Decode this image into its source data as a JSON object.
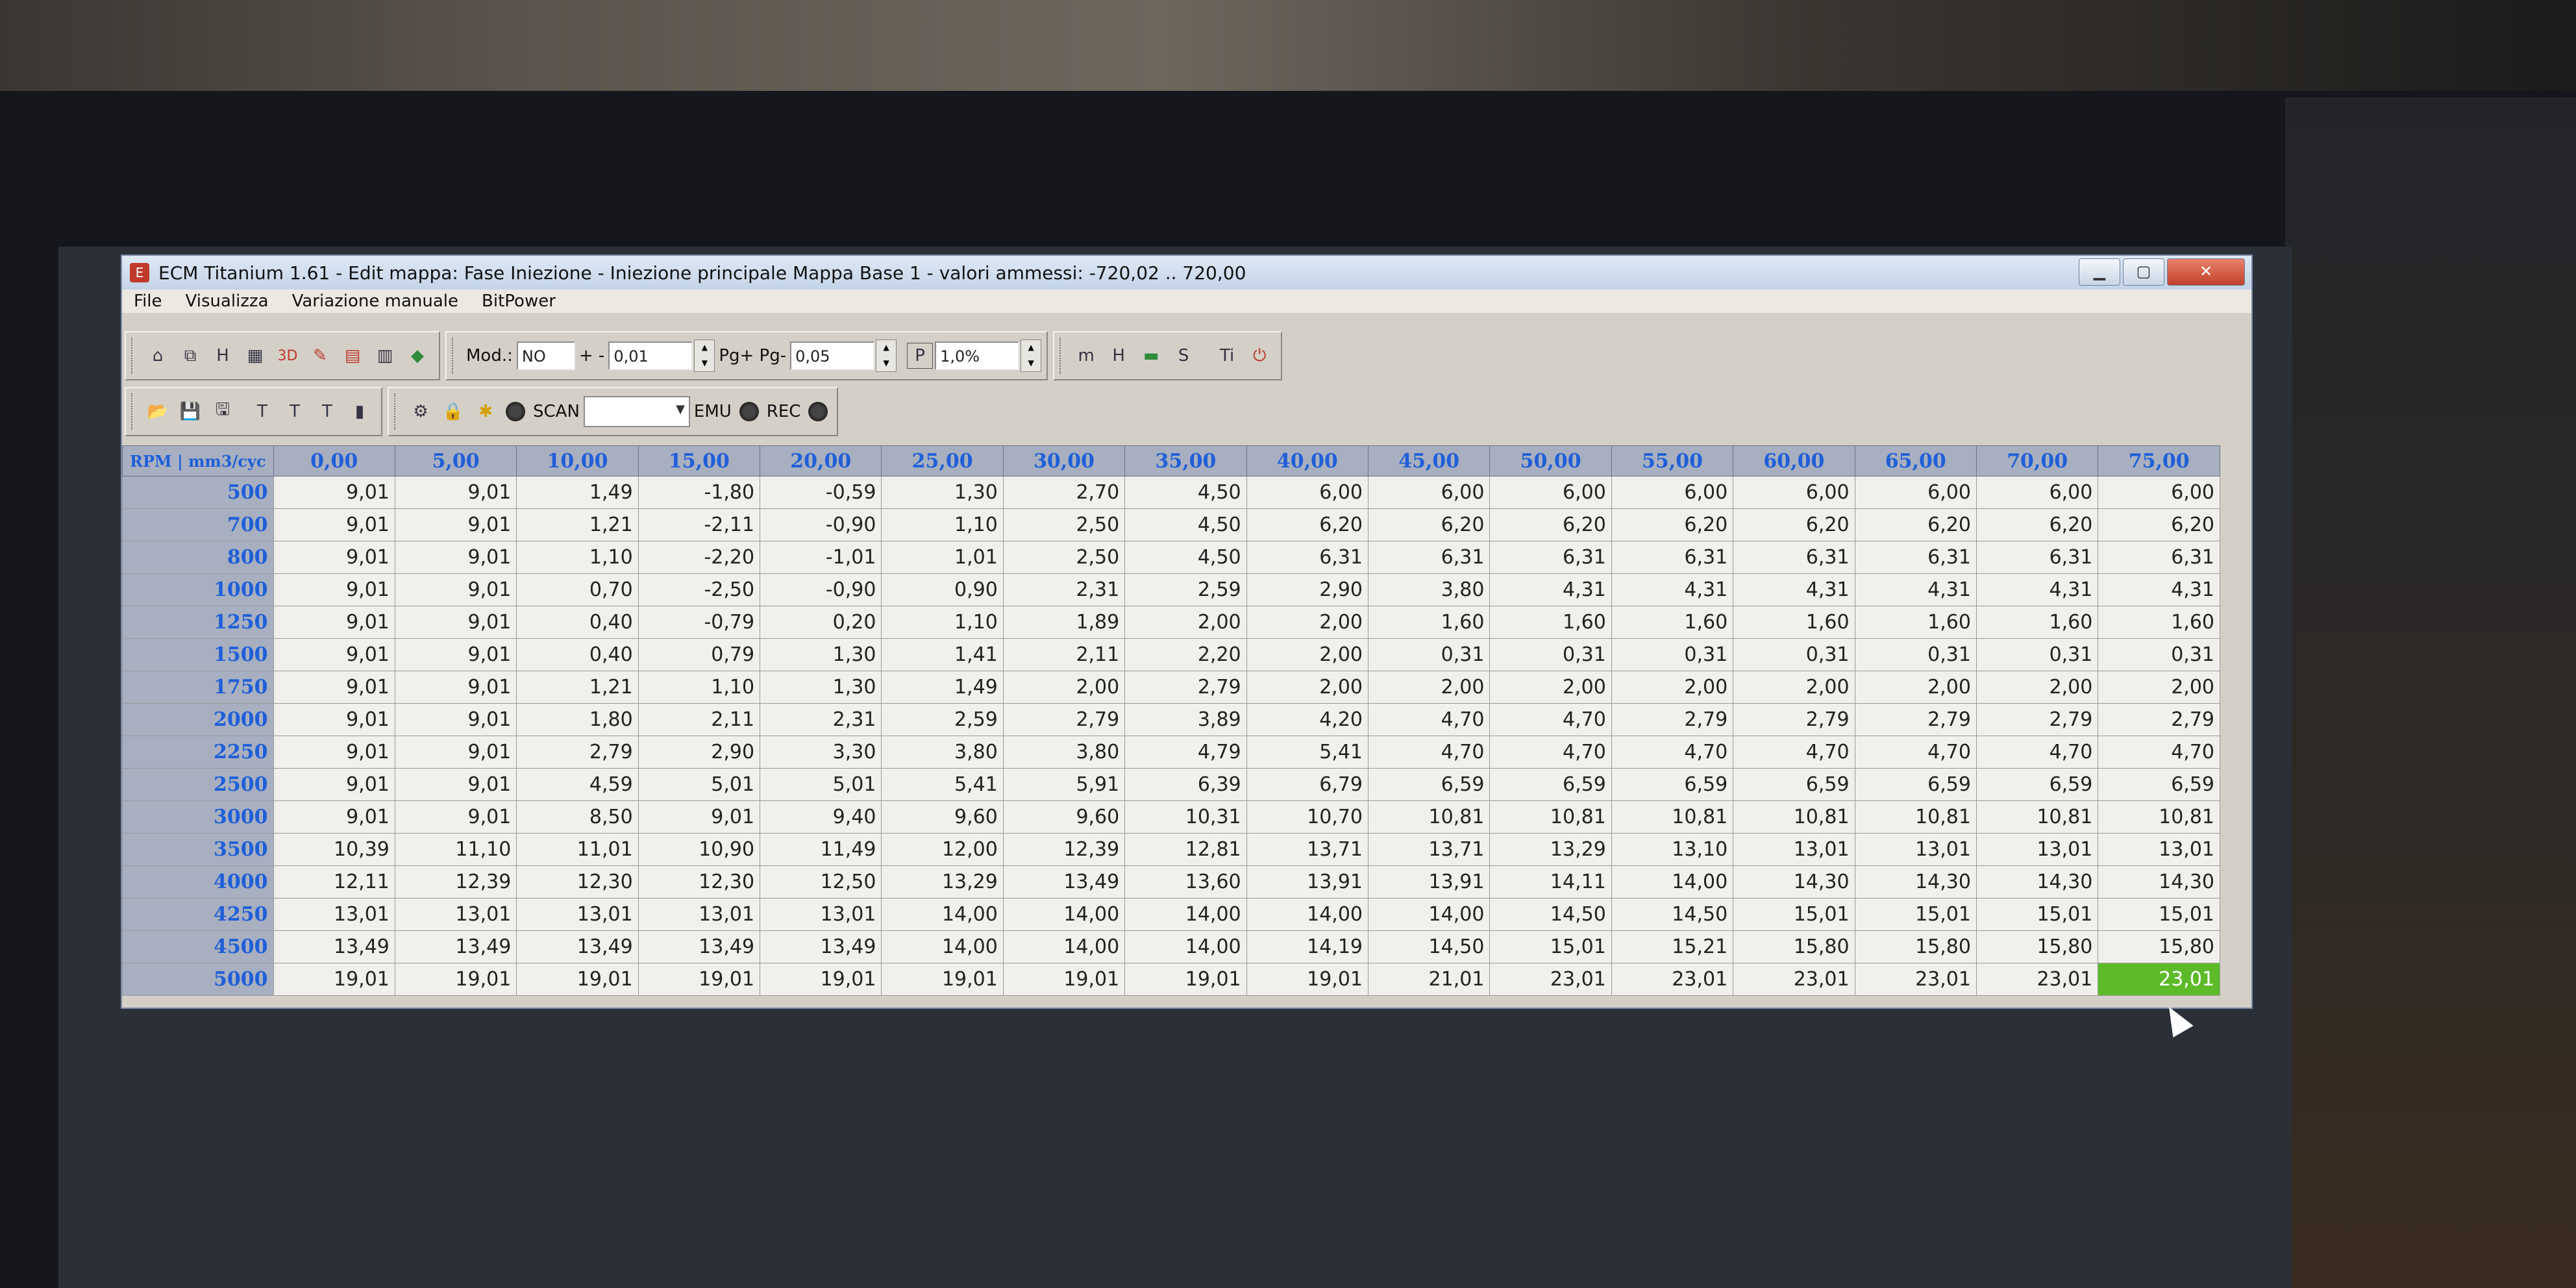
{
  "window": {
    "title": "ECM Titanium 1.61 - Edit mappa: Fase Iniezione - Iniezione principale Mappa Base 1 - valori ammessi: -720,02 .. 720,00",
    "minimize": "▁",
    "maximize": "▢",
    "close": "✕"
  },
  "menu": [
    "File",
    "Visualizza",
    "Variazione manuale",
    "BitPower"
  ],
  "toolbar1": {
    "mod_label": "Mod.:",
    "mod_value": "NO",
    "step_label": "+ -",
    "step_value": "0,01",
    "pg_label": "Pg+ Pg-",
    "pg_value": "0,05",
    "pct_icon": "P",
    "pct_value": "1,0%"
  },
  "toolbar2": {
    "scan_label": "SCAN",
    "emu_label": "EMU",
    "rec_label": "REC"
  },
  "icons": {
    "home": "⌂",
    "copy": "⧉",
    "hex": "H",
    "table": "▦",
    "3d": "3D",
    "edit": "✎",
    "chart": "▤",
    "doc": "▥",
    "color": "◆",
    "open": "📂",
    "save": "💾",
    "saveas": "🖫",
    "t1": "T",
    "t2": "T",
    "t3": "T",
    "t4": "▮",
    "tool": "⚙",
    "lock": "🔒",
    "run": "✱",
    "m": "m",
    "h": "H",
    "flag": "▬",
    "s": "S",
    "ti": "Ti",
    "power": "⏻"
  },
  "table": {
    "corner": "RPM | mm3/cyc",
    "columns": [
      "0,00",
      "5,00",
      "10,00",
      "15,00",
      "20,00",
      "25,00",
      "30,00",
      "35,00",
      "40,00",
      "45,00",
      "50,00",
      "55,00",
      "60,00",
      "65,00",
      "70,00",
      "75,00"
    ],
    "rows": [
      {
        "rpm": "500",
        "values": [
          "9,01",
          "9,01",
          "1,49",
          "-1,80",
          "-0,59",
          "1,30",
          "2,70",
          "4,50",
          "6,00",
          "6,00",
          "6,00",
          "6,00",
          "6,00",
          "6,00",
          "6,00",
          "6,00"
        ]
      },
      {
        "rpm": "700",
        "values": [
          "9,01",
          "9,01",
          "1,21",
          "-2,11",
          "-0,90",
          "1,10",
          "2,50",
          "4,50",
          "6,20",
          "6,20",
          "6,20",
          "6,20",
          "6,20",
          "6,20",
          "6,20",
          "6,20"
        ]
      },
      {
        "rpm": "800",
        "values": [
          "9,01",
          "9,01",
          "1,10",
          "-2,20",
          "-1,01",
          "1,01",
          "2,50",
          "4,50",
          "6,31",
          "6,31",
          "6,31",
          "6,31",
          "6,31",
          "6,31",
          "6,31",
          "6,31"
        ]
      },
      {
        "rpm": "1000",
        "values": [
          "9,01",
          "9,01",
          "0,70",
          "-2,50",
          "-0,90",
          "0,90",
          "2,31",
          "2,59",
          "2,90",
          "3,80",
          "4,31",
          "4,31",
          "4,31",
          "4,31",
          "4,31",
          "4,31"
        ]
      },
      {
        "rpm": "1250",
        "values": [
          "9,01",
          "9,01",
          "0,40",
          "-0,79",
          "0,20",
          "1,10",
          "1,89",
          "2,00",
          "2,00",
          "1,60",
          "1,60",
          "1,60",
          "1,60",
          "1,60",
          "1,60",
          "1,60"
        ]
      },
      {
        "rpm": "1500",
        "values": [
          "9,01",
          "9,01",
          "0,40",
          "0,79",
          "1,30",
          "1,41",
          "2,11",
          "2,20",
          "2,00",
          "0,31",
          "0,31",
          "0,31",
          "0,31",
          "0,31",
          "0,31",
          "0,31"
        ]
      },
      {
        "rpm": "1750",
        "values": [
          "9,01",
          "9,01",
          "1,21",
          "1,10",
          "1,30",
          "1,49",
          "2,00",
          "2,79",
          "2,00",
          "2,00",
          "2,00",
          "2,00",
          "2,00",
          "2,00",
          "2,00",
          "2,00"
        ]
      },
      {
        "rpm": "2000",
        "values": [
          "9,01",
          "9,01",
          "1,80",
          "2,11",
          "2,31",
          "2,59",
          "2,79",
          "3,89",
          "4,20",
          "4,70",
          "4,70",
          "2,79",
          "2,79",
          "2,79",
          "2,79",
          "2,79"
        ]
      },
      {
        "rpm": "2250",
        "values": [
          "9,01",
          "9,01",
          "2,79",
          "2,90",
          "3,30",
          "3,80",
          "3,80",
          "4,79",
          "5,41",
          "4,70",
          "4,70",
          "4,70",
          "4,70",
          "4,70",
          "4,70",
          "4,70"
        ]
      },
      {
        "rpm": "2500",
        "values": [
          "9,01",
          "9,01",
          "4,59",
          "5,01",
          "5,01",
          "5,41",
          "5,91",
          "6,39",
          "6,79",
          "6,59",
          "6,59",
          "6,59",
          "6,59",
          "6,59",
          "6,59",
          "6,59"
        ]
      },
      {
        "rpm": "3000",
        "values": [
          "9,01",
          "9,01",
          "8,50",
          "9,01",
          "9,40",
          "9,60",
          "9,60",
          "10,31",
          "10,70",
          "10,81",
          "10,81",
          "10,81",
          "10,81",
          "10,81",
          "10,81",
          "10,81"
        ]
      },
      {
        "rpm": "3500",
        "values": [
          "10,39",
          "11,10",
          "11,01",
          "10,90",
          "11,49",
          "12,00",
          "12,39",
          "12,81",
          "13,71",
          "13,71",
          "13,29",
          "13,10",
          "13,01",
          "13,01",
          "13,01",
          "13,01"
        ]
      },
      {
        "rpm": "4000",
        "values": [
          "12,11",
          "12,39",
          "12,30",
          "12,30",
          "12,50",
          "13,29",
          "13,49",
          "13,60",
          "13,91",
          "13,91",
          "14,11",
          "14,00",
          "14,30",
          "14,30",
          "14,30",
          "14,30"
        ]
      },
      {
        "rpm": "4250",
        "values": [
          "13,01",
          "13,01",
          "13,01",
          "13,01",
          "13,01",
          "14,00",
          "14,00",
          "14,00",
          "14,00",
          "14,00",
          "14,50",
          "14,50",
          "15,01",
          "15,01",
          "15,01",
          "15,01"
        ]
      },
      {
        "rpm": "4500",
        "values": [
          "13,49",
          "13,49",
          "13,49",
          "13,49",
          "13,49",
          "14,00",
          "14,00",
          "14,00",
          "14,19",
          "14,50",
          "15,01",
          "15,21",
          "15,80",
          "15,80",
          "15,80",
          "15,80"
        ]
      },
      {
        "rpm": "5000",
        "values": [
          "19,01",
          "19,01",
          "19,01",
          "19,01",
          "19,01",
          "19,01",
          "19,01",
          "19,01",
          "19,01",
          "21,01",
          "23,01",
          "23,01",
          "23,01",
          "23,01",
          "23,01",
          "23,01"
        ]
      }
    ],
    "selected_cell": {
      "row": 15,
      "col": 15
    },
    "selected_color": "#5dbb2a",
    "header_color": "#1f5fd8"
  }
}
